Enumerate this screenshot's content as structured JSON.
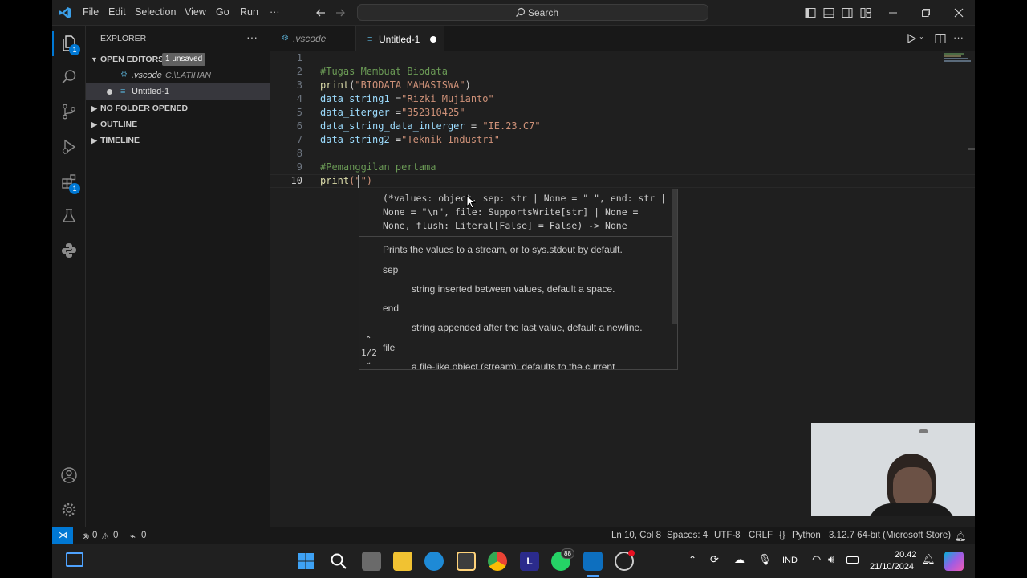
{
  "menu": {
    "file": "File",
    "edit": "Edit",
    "selection": "Selection",
    "view": "View",
    "go": "Go",
    "run": "Run",
    "more": "···"
  },
  "search": {
    "label": "Search"
  },
  "explorer": {
    "title": "EXPLORER",
    "open_editors": "OPEN EDITORS",
    "unsaved_badge": "1 unsaved",
    "files": [
      {
        "name": ".vscode",
        "path": "C:\\LATIHAN"
      },
      {
        "name": "Untitled-1",
        "path": ""
      }
    ],
    "no_folder": "NO FOLDER OPENED",
    "outline": "OUTLINE",
    "timeline": "TIMELINE"
  },
  "activity_badges": {
    "explorer": "1",
    "extensions": "1"
  },
  "tabs": [
    {
      "label": ".vscode"
    },
    {
      "label": "Untitled-1"
    }
  ],
  "editor": {
    "line_numbers": [
      "1",
      "2",
      "3",
      "4",
      "5",
      "6",
      "7",
      "8",
      "9",
      "10"
    ],
    "lines": {
      "l2": "#Tugas Membuat Biodata",
      "l3_fn": "print",
      "l3_open": "(",
      "l3_str": "\"BIODATA MAHASISWA\"",
      "l3_close": ")",
      "l4_var": "data_string1",
      "l4_eq": " =",
      "l4_str": "\"Rizki Mujianto\"",
      "l5_var": "data_iterger",
      "l5_eq": " =",
      "l5_str": "\"352310425\"",
      "l6_var": "data_string_data_interger",
      "l6_eq": " = ",
      "l6_str": "\"IE.23.C7\"",
      "l7_var": "data_string2",
      "l7_eq": " =",
      "l7_str": "\"Teknik Industri\"",
      "l9": "#Pemanggilan pertama",
      "l10_fn": "print",
      "l10_rest": "(\"\")"
    }
  },
  "hover": {
    "signature": "(*values: object, sep: str | None = \" \", end: str | None = \"\\n\", file: SupportsWrite[str] | None = None, flush: Literal[False] = False) -> None",
    "description": "Prints the values to a stream, or to sys.stdout by default.",
    "params": [
      {
        "name": "sep",
        "desc": "string inserted between values, default a space."
      },
      {
        "name": "end",
        "desc": "string appended after the last value, default a newline."
      },
      {
        "name": "file",
        "desc": "a file-like object (stream); defaults to the current"
      }
    ],
    "page": "1/2"
  },
  "status": {
    "errors": "0",
    "warnings": "0",
    "ports": "0",
    "position": "Ln 10, Col 8",
    "spaces": "Spaces: 4",
    "encoding": "UTF-8",
    "eol": "CRLF",
    "language": "Python",
    "interpreter": "3.12.7 64-bit (Microsoft Store)"
  },
  "taskbar": {
    "lang": "IND",
    "time": "20.42",
    "date": "21/10/2024",
    "whatsapp_badge": "88"
  },
  "colors": {
    "accent": "#0078d4",
    "remote": "#0078d4"
  }
}
